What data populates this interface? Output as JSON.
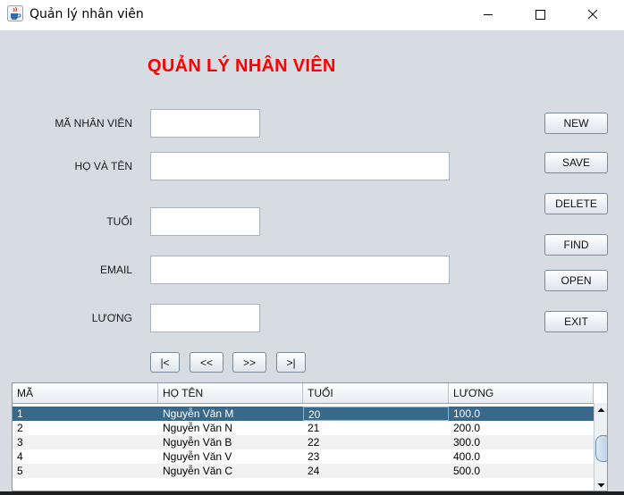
{
  "window": {
    "title": "Quản lý nhân viên",
    "icon": "java-cup-icon"
  },
  "form": {
    "heading": "QUẢN LÝ NHÂN VIÊN",
    "fields": {
      "ma_label": "MÃ NHÂN VIÊN",
      "ma_value": "",
      "hoten_label": "HỌ VÀ TÊN",
      "hoten_value": "",
      "tuoi_label": "TUỔI",
      "tuoi_value": "",
      "email_label": "EMAIL",
      "email_value": "",
      "luong_label": "LƯƠNG",
      "luong_value": ""
    }
  },
  "actions": {
    "new": "NEW",
    "save": "SAVE",
    "delete": "DELETE",
    "find": "FIND",
    "open": "OPEN",
    "exit": "EXIT"
  },
  "navigation": {
    "first": "|<",
    "prev": "<<",
    "next": ">>",
    "last": ">|"
  },
  "table": {
    "columns": [
      "MÃ",
      "HỌ TÊN",
      "TUỔI",
      "LƯƠNG"
    ],
    "rows": [
      {
        "ma": "1",
        "hoten": "Nguyễn Văn M",
        "tuoi": "20",
        "luong": "100.0",
        "selected": true
      },
      {
        "ma": "2",
        "hoten": "Nguyễn Văn N",
        "tuoi": "21",
        "luong": "200.0"
      },
      {
        "ma": "3",
        "hoten": "Nguyễn Văn B",
        "tuoi": "22",
        "luong": "300.0"
      },
      {
        "ma": "4",
        "hoten": "Nguyễn Văn V",
        "tuoi": "23",
        "luong": "400.0"
      },
      {
        "ma": "5",
        "hoten": "Nguyễn Văn C",
        "tuoi": "24",
        "luong": "500.0"
      }
    ]
  },
  "colors": {
    "heading": "#ff0000",
    "selected_row": "#39698a",
    "window_bg": "#d7dbe2"
  }
}
